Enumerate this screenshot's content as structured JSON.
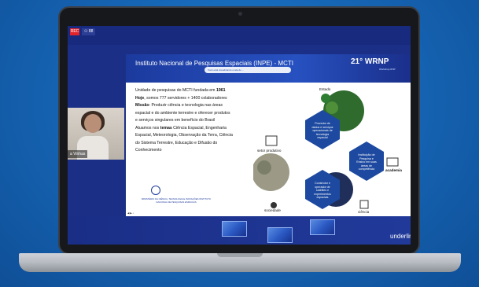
{
  "meeting": {
    "rec_label": "REC",
    "participants_label": "⚇ 88",
    "share_notice": "Você está visualizando a tela de ..."
  },
  "slide": {
    "title": "Instituto Nacional de Pesquisas Espaciais (INPE) - MCTI",
    "wrnp_edition": "21° WRNP",
    "wrnp_subtitle": "Workshop RNP",
    "body_lines": [
      {
        "pre": "Unidade de pesquisas do MCTI fundada em ",
        "bold": "1961",
        "post": ""
      },
      {
        "pre": "",
        "bold": "Hoje",
        "post": ", somos  777 servidores + 1400 colaboradores"
      },
      {
        "pre": "",
        "bold": "Missão",
        "post": ": Produzir ciência e tecnologia nas áreas"
      },
      {
        "pre": "espacial e do ambiente terrestre e oferecer produtos",
        "bold": "",
        "post": ""
      },
      {
        "pre": "e serviços singulares em benefício do Brasil",
        "bold": "",
        "post": ""
      },
      {
        "pre": "Atuamos nos ",
        "bold": "temas",
        "post": " Ciência Espacial, Engenharia"
      },
      {
        "pre": "Espacial, Meteorologia, Observação da Terra, Ciência",
        "bold": "",
        "post": ""
      },
      {
        "pre": "do Sistema Terrestre, Educação e Difusão do",
        "bold": "",
        "post": ""
      },
      {
        "pre": "Conhecimento",
        "bold": "",
        "post": ""
      }
    ],
    "inpe_logo_text": "MINISTÉRIO DA CIÊNCIA, TECNOLOGIA E INOVAÇÕES\nINSTITUTO NACIONAL DE PESQUISAS ESPACIAIS",
    "diagram": {
      "estado": "Estado",
      "setor_produtivo": "setor produtivo",
      "sociedade": "sociedade",
      "ciencia": "ciência",
      "academia": "academia",
      "hex_top": "Provedor de\ndados e serviços\noperacionais de\ntecnologia\nespacial",
      "hex_right": "Instituição de\nPesquisa e\nEnsino em suas\náreas de\ncompetência",
      "hex_bottom": "Construtor e\noperador de\nsatélites e\nexperimentos\nespaciais"
    }
  },
  "speaker": {
    "name": "a Vinhas"
  },
  "branding": {
    "footer_brand": "underlin"
  },
  "colors": {
    "background": "#1666b6",
    "screen": "#1b2f86",
    "hex_blue": "#1d4aa0",
    "rec": "#e1242b"
  }
}
